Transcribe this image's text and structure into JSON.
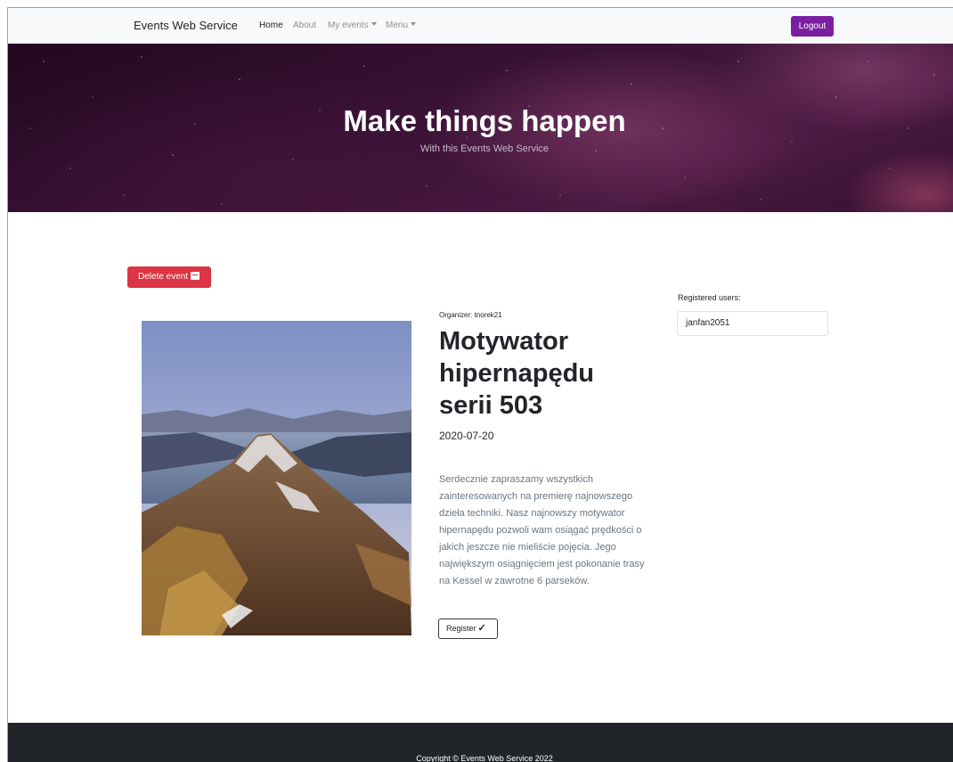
{
  "navbar": {
    "brand": "Events Web Service",
    "links": [
      {
        "label": "Home",
        "active": true
      },
      {
        "label": "About",
        "active": false
      },
      {
        "label": "My events",
        "active": false,
        "dropdown": true
      },
      {
        "label": "Menu",
        "active": false,
        "dropdown": true
      }
    ],
    "logout_label": "Logout",
    "accent": "#7b1fa2"
  },
  "hero": {
    "title": "Make things happen",
    "subtitle": "With this Events Web Service"
  },
  "event": {
    "delete_label": "Delete event",
    "delete_icon": "trash-icon",
    "organizer": "Organizer: tnorek21",
    "title": "Motywator hipernapędu serii 503",
    "date": "2020-07-20",
    "description": "Serdecznie zapraszamy wszystkich zainteresowanych na premierę najnowszego dzieła techniki. Nasz najnowszy motywator hipernapędu pozwoli wam osiągać prędkości o jakich jeszcze nie mieliście pojęcia. Jego największym osiągnięciem jest pokonanie trasy na Kessel w zawrotne 6 parseków.",
    "register_label": "Register",
    "register_icon": "check-icon"
  },
  "registered": {
    "label": "Registered users:",
    "users": [
      "janfan2051"
    ]
  },
  "footer": {
    "copyright": "Copyright © Events Web Service 2022"
  },
  "colors": {
    "danger": "#dc3545",
    "footer_bg": "#212529"
  }
}
